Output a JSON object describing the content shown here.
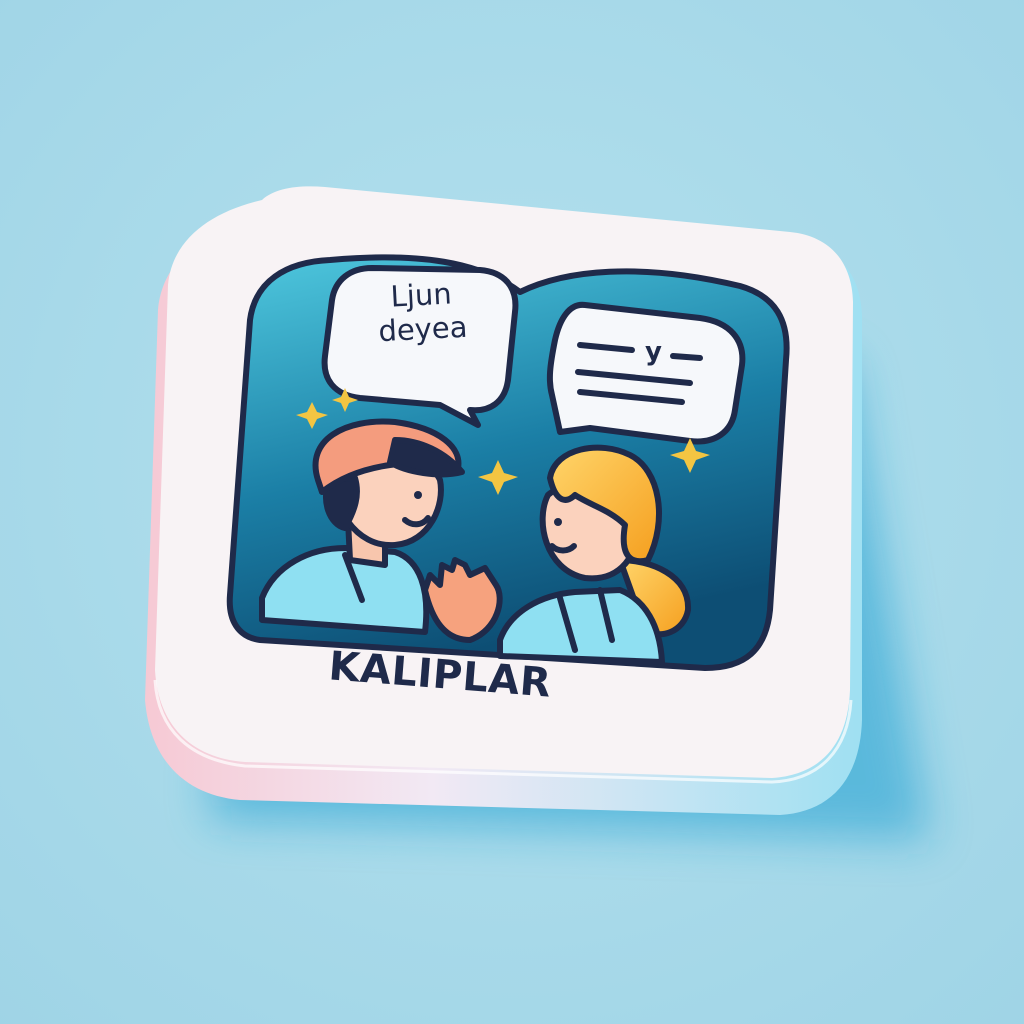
{
  "icon": {
    "caption": "KALIPLAR",
    "left_bubble": {
      "line1": "Ljun",
      "line2": "deyea"
    },
    "right_bubble": {
      "glyph": "y"
    },
    "colors": {
      "background": "#a9dbe9",
      "tile": "#f8f3f5",
      "panel_dark": "#0f5e86",
      "panel_light": "#48c7e0",
      "outline": "#1f2a4a",
      "cap": "#f49c7e",
      "hair_blonde": "#f7b731",
      "shirt": "#8fe0f2",
      "star": "#f3c542"
    }
  }
}
